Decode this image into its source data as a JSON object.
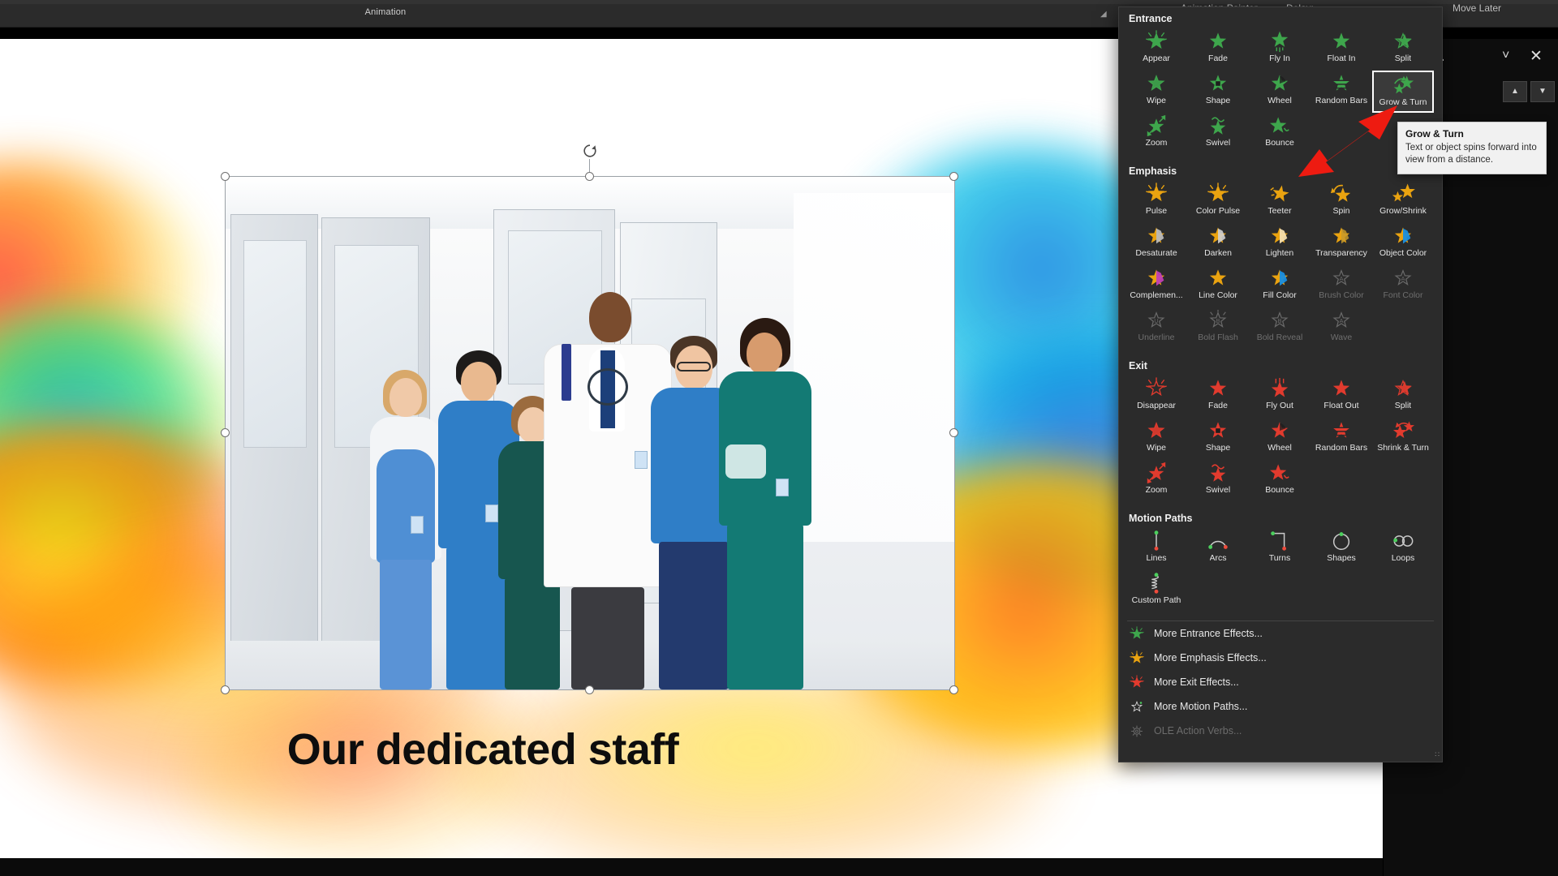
{
  "app": {
    "ribbon_group_label": "Animation",
    "ribbon_controls": [
      {
        "name": "animation-painter",
        "label": "Animation Painter"
      },
      {
        "name": "delay",
        "label": "Delay:"
      },
      {
        "name": "move-later",
        "label": "Move Later"
      }
    ]
  },
  "animation_pane": {
    "title": "tion Pa..",
    "chevron_icon": "chevron-down-icon",
    "close_icon": "close-icon",
    "move-up_label": "▲",
    "move-down_label": "▼"
  },
  "slide": {
    "title": "Our dedicated staff",
    "picture_alt": "medical staff group photo"
  },
  "gallery": {
    "sections": [
      {
        "name": "entrance",
        "title": "Entrance",
        "color": "#3ea64c",
        "items": [
          {
            "label": "Appear",
            "icon": "star-sparkle-icon",
            "state": "normal"
          },
          {
            "label": "Fade",
            "icon": "star-fade-icon",
            "state": "normal"
          },
          {
            "label": "Fly In",
            "icon": "star-flyin-icon",
            "state": "normal"
          },
          {
            "label": "Float In",
            "icon": "star-float-icon",
            "state": "normal"
          },
          {
            "label": "Split",
            "icon": "star-split-icon",
            "state": "normal"
          },
          {
            "label": "Wipe",
            "icon": "star-wipe-icon",
            "state": "normal"
          },
          {
            "label": "Shape",
            "icon": "star-shape-icon",
            "state": "normal"
          },
          {
            "label": "Wheel",
            "icon": "star-wheel-icon",
            "state": "normal"
          },
          {
            "label": "Random Bars",
            "icon": "star-bars-icon",
            "state": "normal"
          },
          {
            "label": "Grow & Turn",
            "icon": "star-grow-turn-icon",
            "state": "selected"
          },
          {
            "label": "Zoom",
            "icon": "star-zoom-icon",
            "state": "normal"
          },
          {
            "label": "Swivel",
            "icon": "star-swivel-icon",
            "state": "normal"
          },
          {
            "label": "Bounce",
            "icon": "star-bounce-icon",
            "state": "normal"
          }
        ]
      },
      {
        "name": "emphasis",
        "title": "Emphasis",
        "color": "#eaa310",
        "items": [
          {
            "label": "Pulse",
            "icon": "star-pulse-icon",
            "state": "normal"
          },
          {
            "label": "Color Pulse",
            "icon": "star-colorpulse-icon",
            "state": "normal"
          },
          {
            "label": "Teeter",
            "icon": "star-teeter-icon",
            "state": "normal"
          },
          {
            "label": "Spin",
            "icon": "star-spin-icon",
            "state": "normal"
          },
          {
            "label": "Grow/Shrink",
            "icon": "star-growshrink-icon",
            "state": "normal"
          },
          {
            "label": "Desaturate",
            "icon": "star-desaturate-icon",
            "state": "normal"
          },
          {
            "label": "Darken",
            "icon": "star-darken-icon",
            "state": "normal"
          },
          {
            "label": "Lighten",
            "icon": "star-lighten-icon",
            "state": "normal"
          },
          {
            "label": "Transparency",
            "icon": "star-transparency-icon",
            "state": "normal"
          },
          {
            "label": "Object Color",
            "icon": "star-objectcolor-icon",
            "state": "normal"
          },
          {
            "label": "Complemen...",
            "icon": "star-complement-icon",
            "state": "normal"
          },
          {
            "label": "Line Color",
            "icon": "star-linecolor-icon",
            "state": "normal"
          },
          {
            "label": "Fill Color",
            "icon": "star-fillcolor-icon",
            "state": "normal"
          },
          {
            "label": "Brush Color",
            "icon": "star-brushcolor-icon",
            "state": "disabled"
          },
          {
            "label": "Font Color",
            "icon": "star-fontcolor-icon",
            "state": "disabled"
          },
          {
            "label": "Underline",
            "icon": "star-underline-icon",
            "state": "disabled"
          },
          {
            "label": "Bold Flash",
            "icon": "star-boldflash-icon",
            "state": "disabled"
          },
          {
            "label": "Bold Reveal",
            "icon": "star-boldreveal-icon",
            "state": "disabled"
          },
          {
            "label": "Wave",
            "icon": "star-wave-icon",
            "state": "disabled"
          }
        ]
      },
      {
        "name": "exit",
        "title": "Exit",
        "color": "#e23b2e",
        "items": [
          {
            "label": "Disappear",
            "icon": "star-disappear-icon",
            "state": "normal"
          },
          {
            "label": "Fade",
            "icon": "star-fade-icon",
            "state": "normal"
          },
          {
            "label": "Fly Out",
            "icon": "star-flyout-icon",
            "state": "normal"
          },
          {
            "label": "Float Out",
            "icon": "star-float-icon",
            "state": "normal"
          },
          {
            "label": "Split",
            "icon": "star-split-icon",
            "state": "normal"
          },
          {
            "label": "Wipe",
            "icon": "star-wipe-icon",
            "state": "normal"
          },
          {
            "label": "Shape",
            "icon": "star-shape-icon",
            "state": "normal"
          },
          {
            "label": "Wheel",
            "icon": "star-wheel-icon",
            "state": "normal"
          },
          {
            "label": "Random Bars",
            "icon": "star-bars-icon",
            "state": "normal"
          },
          {
            "label": "Shrink & Turn",
            "icon": "star-shrink-turn-icon",
            "state": "normal"
          },
          {
            "label": "Zoom",
            "icon": "star-zoom-icon",
            "state": "normal"
          },
          {
            "label": "Swivel",
            "icon": "star-swivel-icon",
            "state": "normal"
          },
          {
            "label": "Bounce",
            "icon": "star-bounce-icon",
            "state": "normal"
          }
        ]
      },
      {
        "name": "motion-paths",
        "title": "Motion Paths",
        "color": "#bdbdbd",
        "items": [
          {
            "label": "Lines",
            "icon": "path-lines-icon",
            "state": "normal"
          },
          {
            "label": "Arcs",
            "icon": "path-arcs-icon",
            "state": "normal"
          },
          {
            "label": "Turns",
            "icon": "path-turns-icon",
            "state": "normal"
          },
          {
            "label": "Shapes",
            "icon": "path-shapes-icon",
            "state": "normal"
          },
          {
            "label": "Loops",
            "icon": "path-loops-icon",
            "state": "normal"
          },
          {
            "label": "Custom Path",
            "icon": "path-custom-icon",
            "state": "normal"
          }
        ]
      }
    ],
    "menu_items": [
      {
        "label": "More Entrance Effects...",
        "icon": "star-green-icon",
        "state": "normal"
      },
      {
        "label": "More Emphasis Effects...",
        "icon": "star-yellow-icon",
        "state": "normal"
      },
      {
        "label": "More Exit Effects...",
        "icon": "star-red-icon",
        "state": "normal"
      },
      {
        "label": "More Motion Paths...",
        "icon": "star-outline-icon",
        "state": "normal"
      },
      {
        "label": "OLE Action Verbs...",
        "icon": "gear-icon",
        "state": "disabled"
      }
    ],
    "resize_grip": "∷"
  },
  "tooltip": {
    "title": "Grow & Turn",
    "body": "Text or object spins forward into view from a distance."
  },
  "annotation": {
    "arrow_color": "#ee1b11",
    "points_to": "Grow & Turn"
  }
}
